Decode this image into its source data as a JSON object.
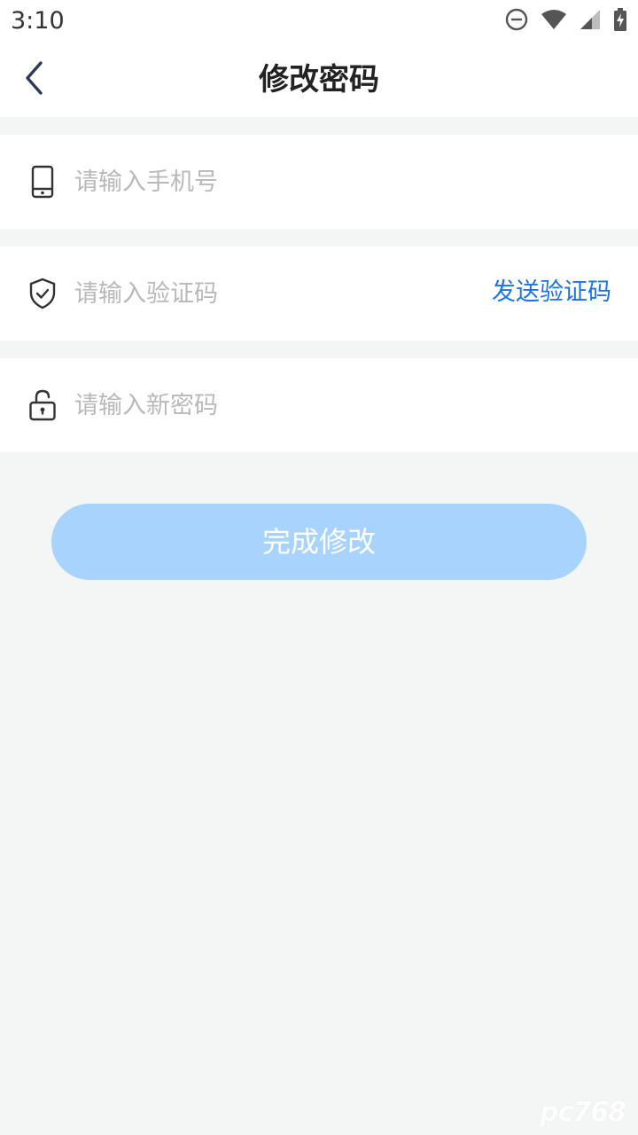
{
  "status_bar": {
    "time": "3:10",
    "icons": [
      "do-not-disturb-icon",
      "wifi-icon",
      "cell-signal-icon",
      "battery-charging-icon"
    ]
  },
  "nav": {
    "title": "修改密码",
    "back_icon": "chevron-left-icon"
  },
  "form": {
    "phone": {
      "placeholder": "请输入手机号",
      "value": "",
      "icon": "phone-icon"
    },
    "code": {
      "placeholder": "请输入验证码",
      "value": "",
      "icon": "shield-check-icon",
      "send_label": "发送验证码"
    },
    "password": {
      "placeholder": "请输入新密码",
      "value": "",
      "icon": "lock-icon"
    }
  },
  "submit_label": "完成修改",
  "watermark": "pc768",
  "colors": {
    "accent": "#1a73e8",
    "button_disabled": "#a8d3fd",
    "page_bg": "#f4f6f6",
    "placeholder": "#b9b9b9"
  }
}
